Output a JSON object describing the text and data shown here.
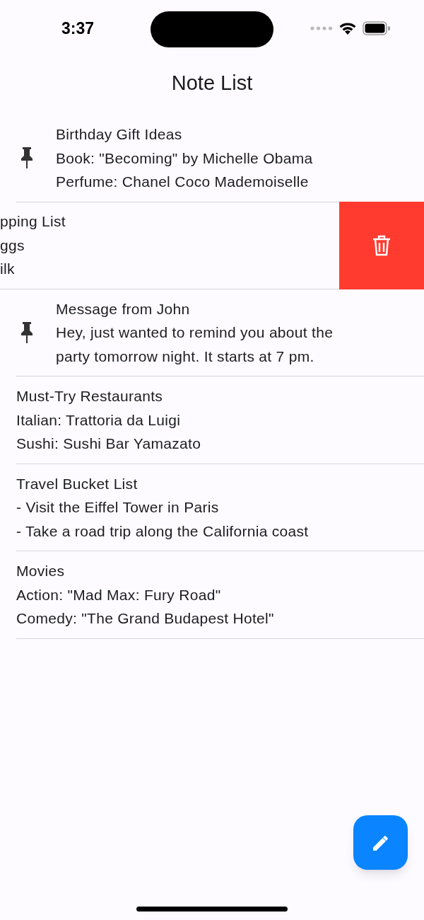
{
  "status_bar": {
    "time": "3:37"
  },
  "title": "Note List",
  "notes": [
    {
      "lines": [
        "Birthday Gift Ideas",
        "Book: \"Becoming\" by Michelle Obama",
        "Perfume: Chanel Coco Mademoiselle"
      ],
      "pinned": true,
      "swiped": false
    },
    {
      "lines": [
        "pping List",
        "ggs",
        "ilk"
      ],
      "pinned": false,
      "swiped": true
    },
    {
      "lines": [
        "Message from John",
        "Hey, just wanted to remind you about the",
        "party tomorrow night. It starts at 7 pm."
      ],
      "pinned": true,
      "swiped": false
    },
    {
      "lines": [
        "Must-Try Restaurants",
        "Italian: Trattoria da Luigi",
        "Sushi: Sushi Bar Yamazato"
      ],
      "pinned": false,
      "swiped": false
    },
    {
      "lines": [
        "Travel Bucket List",
        "- Visit the Eiffel Tower in Paris",
        "- Take a road trip along the California coast"
      ],
      "pinned": false,
      "swiped": false
    },
    {
      "lines": [
        "Movies",
        "Action: \"Mad Max: Fury Road\"",
        "Comedy: \"The Grand Budapest Hotel\""
      ],
      "pinned": false,
      "swiped": false
    }
  ]
}
